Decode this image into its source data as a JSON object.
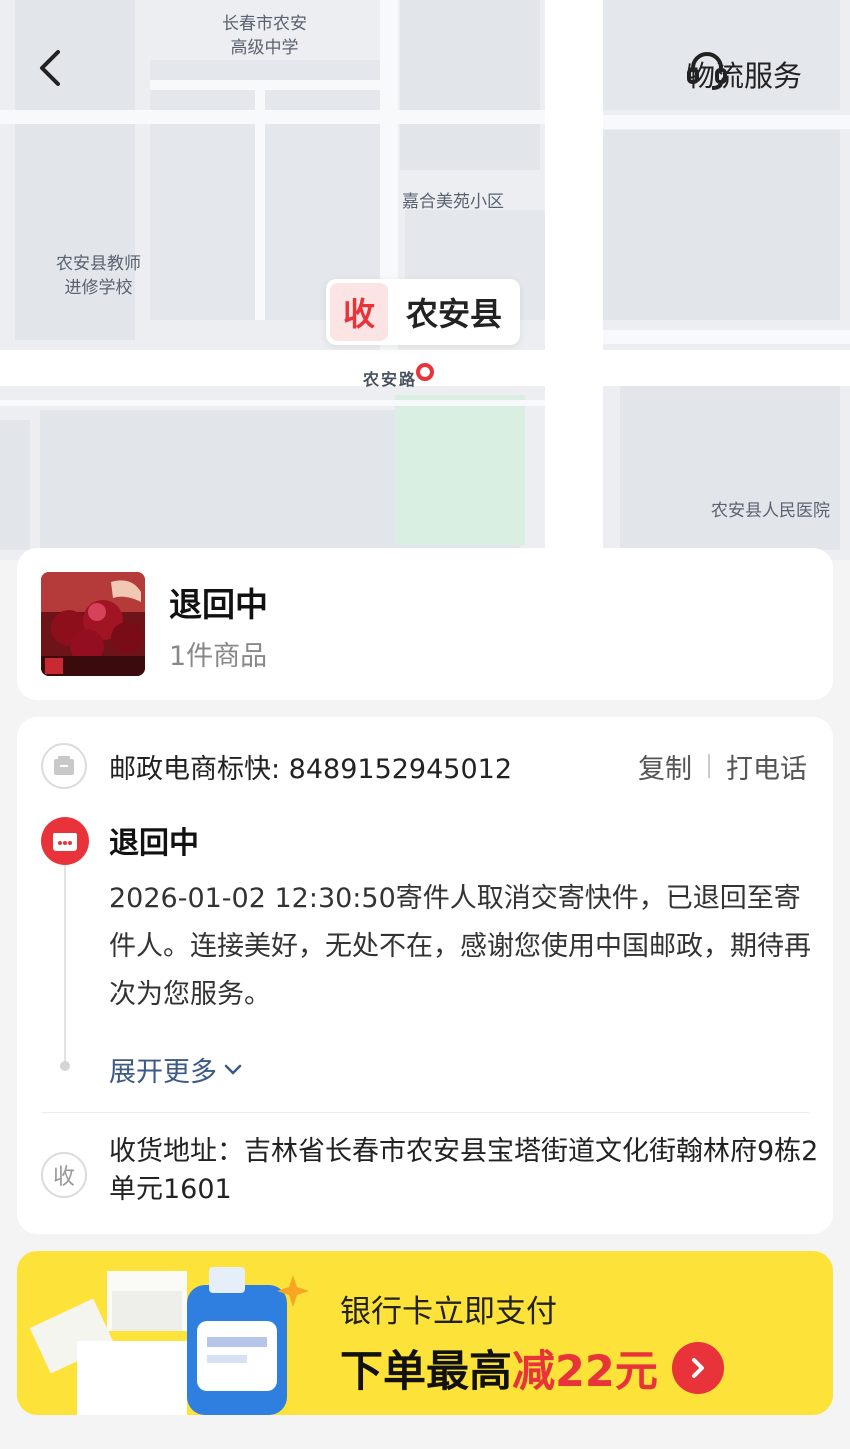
{
  "map": {
    "labels": {
      "school": "长春市农安\n高级中学",
      "residence": "嘉合美苑小区",
      "teacher_college": "农安县教师\n进修学校",
      "road": "农安路",
      "hospital": "农安县人民医院"
    },
    "pin": {
      "badge": "收",
      "place": "农安县"
    }
  },
  "header": {
    "back_icon": "chevron-left-icon",
    "service_label": "物流服务",
    "service_icon": "headset-icon"
  },
  "status_card": {
    "title": "退回中",
    "subtitle": "1件商品"
  },
  "tracking": {
    "carrier_text": "邮政电商标快: 8489152945012",
    "copy_label": "复制",
    "call_label": "打电话"
  },
  "timeline": {
    "title": "退回中",
    "description": "2026-01-02 12:30:50寄件人取消交寄快件，已退回至寄件人。连接美好，无处不在，感谢您使用中国邮政，期待再次为您服务。",
    "expand_label": "展开更多"
  },
  "address": {
    "icon_text": "收",
    "text": "收货地址：吉林省长春市农安县宝塔街道文化街翰林府9栋2单元1601"
  },
  "banner": {
    "line1": "银行卡立即支付",
    "line2_prefix": "下单最高",
    "line2_highlight": "减22元"
  },
  "colors": {
    "accent_red": "#e8333b",
    "banner_yellow": "#fde23a",
    "link_blue": "#3c5a86"
  }
}
